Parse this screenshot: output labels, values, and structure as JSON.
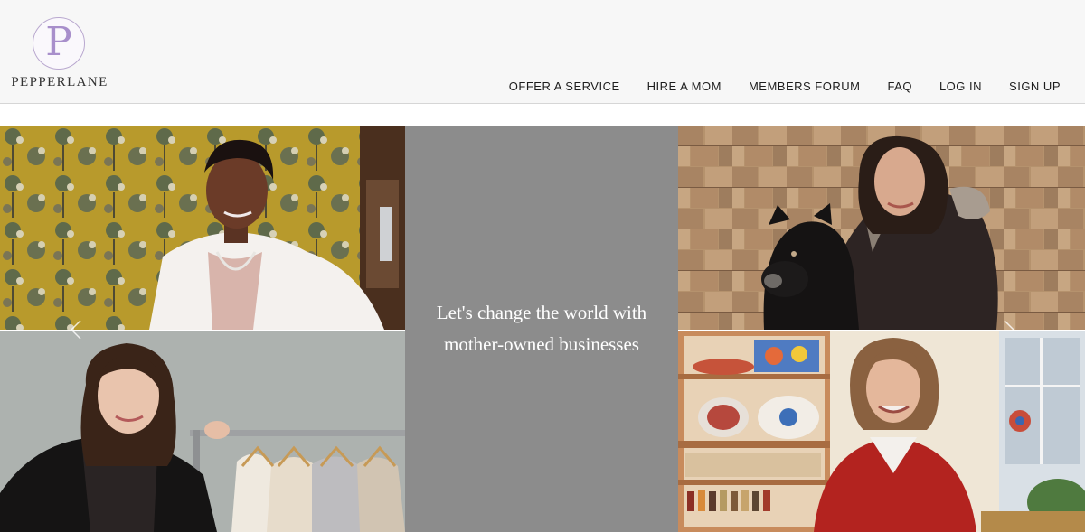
{
  "brand": {
    "logo_letter": "P",
    "name": "PEPPERLANE"
  },
  "nav": {
    "items": [
      {
        "id": "offer-a-service",
        "label": "OFFER A SERVICE"
      },
      {
        "id": "hire-a-mom",
        "label": "HIRE A MOM"
      },
      {
        "id": "members-forum",
        "label": "MEMBERS FORUM"
      },
      {
        "id": "faq",
        "label": "FAQ"
      },
      {
        "id": "log-in",
        "label": "LOG IN"
      },
      {
        "id": "sign-up",
        "label": "SIGN UP"
      }
    ]
  },
  "hero": {
    "tagline_line1": "Let's change the world with",
    "tagline_line2": "mother-owned businesses",
    "prev_icon": "chevron-left-icon",
    "next_icon": "chevron-right-icon"
  },
  "colors": {
    "header_bg": "#f7f7f7",
    "accent_lavender": "#a88fcb",
    "center_panel": "#8c8c8c"
  }
}
